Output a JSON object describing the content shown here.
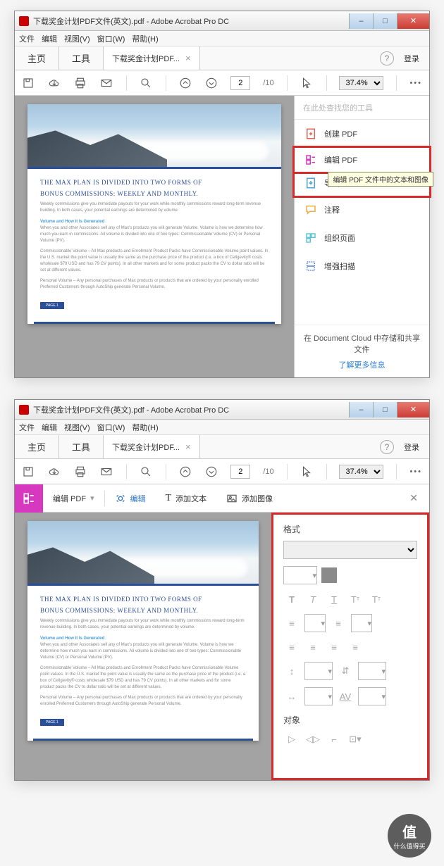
{
  "title_text": "下载奖金计划PDF文件(英文).pdf - Adobe Acrobat Pro DC",
  "menu": {
    "file": "文件",
    "edit": "编辑",
    "view": "视图(V)",
    "window": "窗口(W)",
    "help": "帮助(H)"
  },
  "tabs": {
    "home": "主页",
    "tools": "工具",
    "filename": "下载奖金计划PDF...",
    "login": "登录"
  },
  "toolbar": {
    "page_current": "2",
    "page_total": "/10",
    "zoom": "37.4%"
  },
  "search": {
    "placeholder": "在此处查找您的工具"
  },
  "side_tools": {
    "create": "创建 PDF",
    "edit": "编辑 PDF",
    "export": "导出 PDF",
    "comment": "注释",
    "organize": "组织页面",
    "scan": "增强扫描"
  },
  "tooltip": "编辑 PDF 文件中的文本和图像",
  "cloud": {
    "msg": "在 Document Cloud 中存储和共享文件",
    "link": "了解更多信息"
  },
  "doc": {
    "headline1": "THE MAX PLAN IS DIVIDED INTO TWO FORMS OF",
    "headline2": "BONUS COMMISSIONS: WEEKLY AND MONTHLY.",
    "caption": "Weekly commissions give you immediate payouts for your work while monthly commissions reward long-term revenue building. In both cases, your potential earnings are determined by volume.",
    "sub1": "Volume and How It Is Generated",
    "p1": "When you and other Associates sell any of Max's products you will generate Volume. Volume is how we determine how much you earn in commissions. All volume is divided into one of two types: Commissionable Volume (CV) or Personal Volume (PV).",
    "p2": "Commissionable Volume – All Max products and Enrollment Product Packs have Commissionable Volume point values. In the U.S. market the point value is usually the same as the purchase price of the product (i.e. a box of Cellgevity® costs wholesale $79 USD and has 79 CV points). In all other markets and for some product packs the CV to dollar ratio will be set at different values.",
    "p3": "Personal Volume – Any personal purchases of Max products or products that are ordered by your personally enrolled Preferred Customers through AutoShip generate Personal Volume.",
    "page_label": "PAGE 1"
  },
  "edit_bar": {
    "title": "编辑 PDF",
    "edit": "编辑",
    "add_text": "添加文本",
    "add_image": "添加图像"
  },
  "format": {
    "title": "格式",
    "objects": "对象"
  },
  "watermark": {
    "ch": "值",
    "txt": "什么值得买"
  }
}
